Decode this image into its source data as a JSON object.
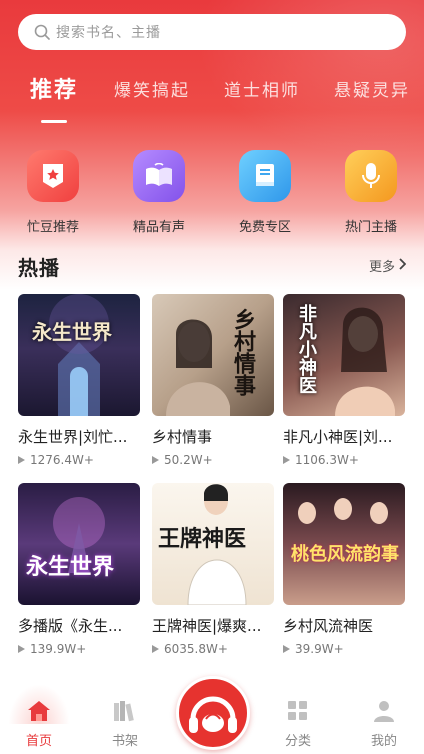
{
  "search": {
    "placeholder": "搜索书名、主播"
  },
  "tabs": [
    {
      "label": "推荐",
      "active": true
    },
    {
      "label": "爆笑搞起",
      "active": false
    },
    {
      "label": "道士相师",
      "active": false
    },
    {
      "label": "悬疑灵异",
      "active": false
    }
  ],
  "quick_links": [
    {
      "label": "忙豆推荐",
      "icon": "star-shield-icon",
      "color": "#f25a5a"
    },
    {
      "label": "精品有声",
      "icon": "book-open-icon",
      "color": "#9b6cf0"
    },
    {
      "label": "免费专区",
      "icon": "book-icon",
      "color": "#3fa7f0"
    },
    {
      "label": "热门主播",
      "icon": "microphone-icon",
      "color": "#f7a93a"
    }
  ],
  "section": {
    "title": "热播",
    "more": "更多"
  },
  "cards": [
    {
      "title": "永生世界|刘忙...",
      "plays": "1276.4W+",
      "cover_text": "永生世界"
    },
    {
      "title": "乡村情事",
      "plays": "50.2W+",
      "cover_text": "乡村情事"
    },
    {
      "title": "非凡小神医|刘...",
      "plays": "1106.3W+",
      "cover_text": "非凡小神医"
    },
    {
      "title": "多播版《永生...",
      "plays": "139.9W+",
      "cover_text": "永生世界"
    },
    {
      "title": "王牌神医|爆爽...",
      "plays": "6035.8W+",
      "cover_text": "王牌神医"
    },
    {
      "title": "乡村风流神医",
      "plays": "39.9W+",
      "cover_text": "桃色风流韵事"
    }
  ],
  "bottom_nav": [
    {
      "label": "首页",
      "icon": "home-icon",
      "active": true
    },
    {
      "label": "书架",
      "icon": "bookshelf-icon",
      "active": false
    },
    {
      "label": "",
      "icon": "mangdou-headphones-logo",
      "active": false
    },
    {
      "label": "分类",
      "icon": "category-grid-icon",
      "active": false
    },
    {
      "label": "我的",
      "icon": "user-icon",
      "active": false
    }
  ],
  "colors": {
    "accent": "#e83b3d",
    "brand_red": "#e6332f"
  }
}
